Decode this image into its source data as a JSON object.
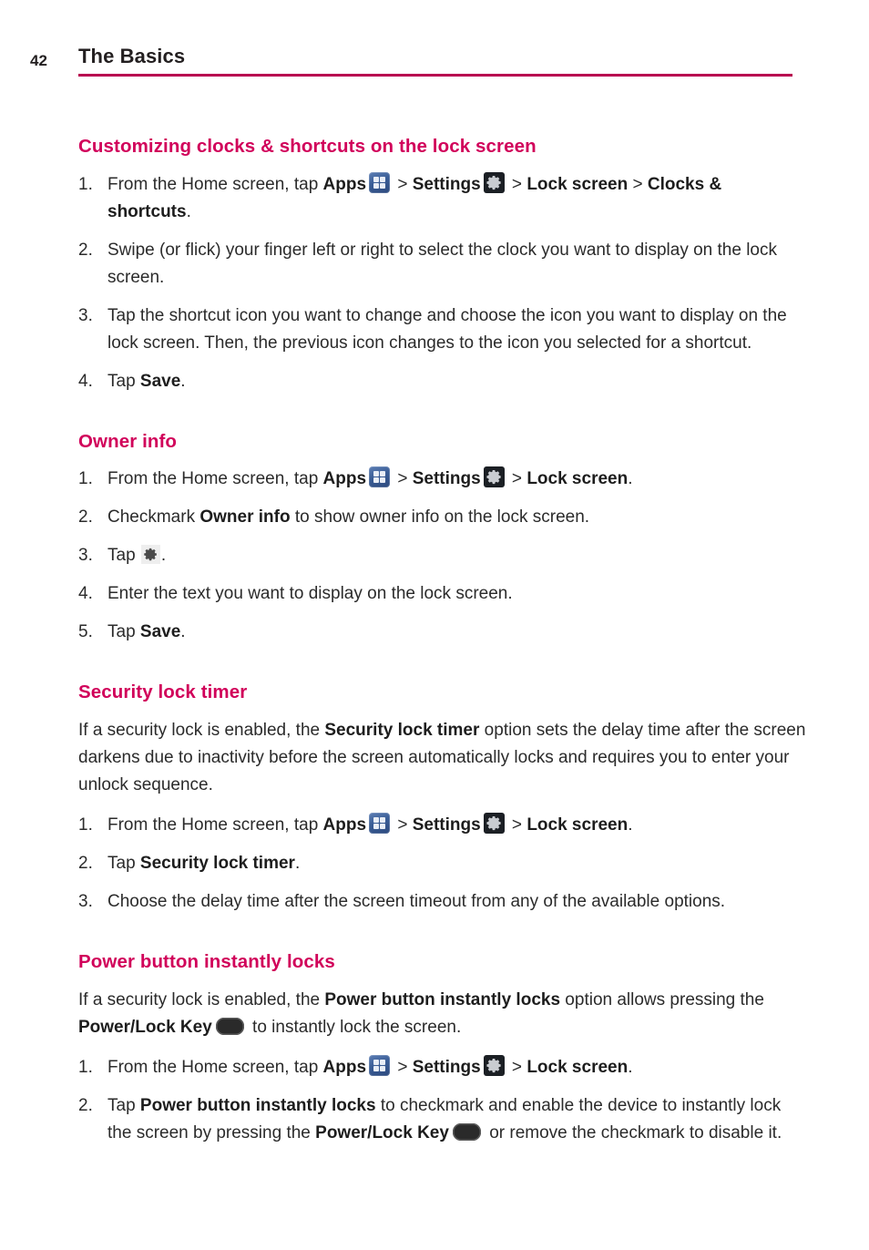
{
  "page": {
    "number": "42",
    "running_head": "The Basics",
    "rule_color": "#b8004f",
    "heading_color": "#d1005a",
    "body_color": "#2b2b2b"
  },
  "icons": {
    "apps": "apps-grid-icon",
    "settings": "settings-gear-icon",
    "gear_small": "gear-icon",
    "power_key": "power-lock-key-icon"
  },
  "sections": [
    {
      "heading": "Customizing clocks & shortcuts on the lock screen",
      "steps": [
        {
          "num": "1.",
          "parts": [
            {
              "t": "From the Home screen, tap ",
              "style": "normal"
            },
            {
              "t": "Apps",
              "style": "bold"
            },
            {
              "t": "apps",
              "style": "icon"
            },
            {
              "t": " > ",
              "style": "normal"
            },
            {
              "t": "Settings",
              "style": "bold"
            },
            {
              "t": "settings",
              "style": "icon"
            },
            {
              "t": " > ",
              "style": "normal"
            },
            {
              "t": "Lock screen",
              "style": "bold"
            },
            {
              "t": " > ",
              "style": "normal"
            },
            {
              "t": "Clocks & shortcuts",
              "style": "bold"
            },
            {
              "t": ".",
              "style": "normal"
            }
          ]
        },
        {
          "num": "2.",
          "parts": [
            {
              "t": "Swipe (or flick) your finger left or right to select the clock you want to display on the lock screen.",
              "style": "normal"
            }
          ]
        },
        {
          "num": "3.",
          "parts": [
            {
              "t": "Tap the shortcut icon you want to change and choose the icon you want to display on the lock screen. Then, the previous icon changes to the icon you selected for a shortcut.",
              "style": "normal"
            }
          ]
        },
        {
          "num": "4.",
          "parts": [
            {
              "t": "Tap ",
              "style": "normal"
            },
            {
              "t": "Save",
              "style": "bold"
            },
            {
              "t": ".",
              "style": "normal"
            }
          ]
        }
      ]
    },
    {
      "heading": "Owner info",
      "steps": [
        {
          "num": "1.",
          "parts": [
            {
              "t": "From the Home screen, tap ",
              "style": "normal"
            },
            {
              "t": "Apps",
              "style": "bold"
            },
            {
              "t": "apps",
              "style": "icon"
            },
            {
              "t": " > ",
              "style": "normal"
            },
            {
              "t": "Settings",
              "style": "bold"
            },
            {
              "t": "settings",
              "style": "icon"
            },
            {
              "t": " > ",
              "style": "normal"
            },
            {
              "t": "Lock screen",
              "style": "bold"
            },
            {
              "t": ".",
              "style": "normal"
            }
          ]
        },
        {
          "num": "2.",
          "parts": [
            {
              "t": "Checkmark ",
              "style": "normal"
            },
            {
              "t": "Owner info",
              "style": "bold"
            },
            {
              "t": " to show owner info on the lock screen.",
              "style": "normal"
            }
          ]
        },
        {
          "num": "3.",
          "parts": [
            {
              "t": "Tap ",
              "style": "normal"
            },
            {
              "t": "gear_small",
              "style": "icon"
            },
            {
              "t": ".",
              "style": "normal"
            }
          ]
        },
        {
          "num": "4.",
          "parts": [
            {
              "t": "Enter the text you want to display on the lock screen.",
              "style": "normal"
            }
          ]
        },
        {
          "num": "5.",
          "parts": [
            {
              "t": "Tap ",
              "style": "normal"
            },
            {
              "t": "Save",
              "style": "bold"
            },
            {
              "t": ".",
              "style": "normal"
            }
          ]
        }
      ]
    },
    {
      "heading": "Security lock timer",
      "intro": [
        {
          "t": "If a security lock is enabled, the ",
          "style": "normal"
        },
        {
          "t": "Security lock timer",
          "style": "bold"
        },
        {
          "t": " option sets the delay time after the screen darkens due to inactivity before the screen automatically locks and requires you to enter your unlock sequence.",
          "style": "normal"
        }
      ],
      "steps": [
        {
          "num": "1.",
          "parts": [
            {
              "t": "From the Home screen, tap ",
              "style": "normal"
            },
            {
              "t": "Apps",
              "style": "bold"
            },
            {
              "t": "apps",
              "style": "icon"
            },
            {
              "t": " > ",
              "style": "normal"
            },
            {
              "t": "Settings",
              "style": "bold"
            },
            {
              "t": "settings",
              "style": "icon"
            },
            {
              "t": " > ",
              "style": "normal"
            },
            {
              "t": "Lock screen",
              "style": "bold"
            },
            {
              "t": ".",
              "style": "normal"
            }
          ]
        },
        {
          "num": "2.",
          "parts": [
            {
              "t": "Tap ",
              "style": "normal"
            },
            {
              "t": "Security lock timer",
              "style": "bold"
            },
            {
              "t": ".",
              "style": "normal"
            }
          ]
        },
        {
          "num": "3.",
          "parts": [
            {
              "t": "Choose the delay time after the screen timeout from any of the available options.",
              "style": "normal"
            }
          ]
        }
      ]
    },
    {
      "heading": "Power button instantly locks",
      "intro": [
        {
          "t": "If a security lock is enabled, the ",
          "style": "normal"
        },
        {
          "t": "Power button instantly locks",
          "style": "bold"
        },
        {
          "t": " option allows pressing the ",
          "style": "normal"
        },
        {
          "t": "Power/Lock Key",
          "style": "bold"
        },
        {
          "t": "power_key",
          "style": "icon"
        },
        {
          "t": " to instantly lock the screen.",
          "style": "normal"
        }
      ],
      "steps": [
        {
          "num": "1.",
          "parts": [
            {
              "t": "From the Home screen, tap ",
              "style": "normal"
            },
            {
              "t": "Apps",
              "style": "bold"
            },
            {
              "t": "apps",
              "style": "icon"
            },
            {
              "t": " > ",
              "style": "normal"
            },
            {
              "t": "Settings",
              "style": "bold"
            },
            {
              "t": "settings",
              "style": "icon"
            },
            {
              "t": " > ",
              "style": "normal"
            },
            {
              "t": "Lock screen",
              "style": "bold"
            },
            {
              "t": ".",
              "style": "normal"
            }
          ]
        },
        {
          "num": "2.",
          "parts": [
            {
              "t": "Tap ",
              "style": "normal"
            },
            {
              "t": "Power button instantly locks",
              "style": "bold"
            },
            {
              "t": " to checkmark and enable the device to instantly lock the screen by pressing the ",
              "style": "normal"
            },
            {
              "t": "Power/Lock Key",
              "style": "bold"
            },
            {
              "t": "power_key",
              "style": "icon"
            },
            {
              "t": " or remove the checkmark to disable it.",
              "style": "normal"
            }
          ]
        }
      ]
    }
  ]
}
